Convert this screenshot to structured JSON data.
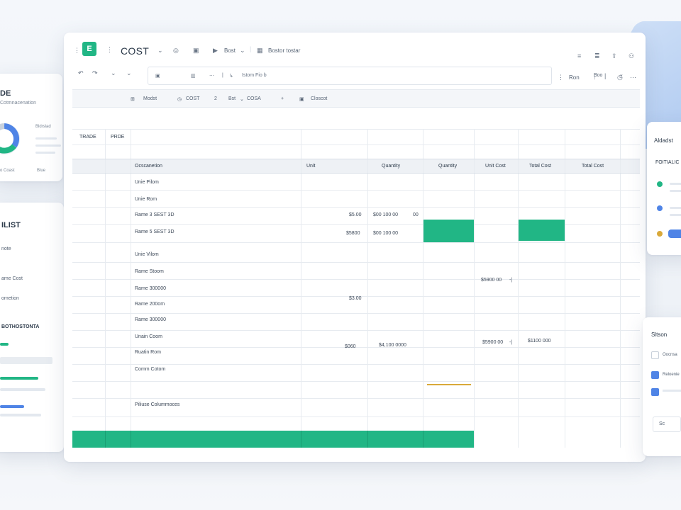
{
  "app": {
    "logo": "E",
    "title": "COST"
  },
  "toolbar": {
    "btn_a": "Bost",
    "btn_b": "Bostor tostar",
    "formula_text": "Istom Fio b",
    "select_value": "Boo",
    "right_text": "Ron"
  },
  "subtoolbar": [
    "Modst",
    "COST",
    "2",
    "Bst",
    "COSA",
    "Closcot"
  ],
  "grid": {
    "top_labels": {
      "trade": "TRADE",
      "pride": "PRDE"
    },
    "headers": [
      "Ocscanetion",
      "Unit",
      "Quantity",
      "Quantity",
      "Unit Cost",
      "Total Cost",
      "Total Cost"
    ],
    "rows": [
      {
        "name": "Unie Pilom",
        "unit": "",
        "qty": ""
      },
      {
        "name": "Unie Rom",
        "unit": "",
        "qty": ""
      },
      {
        "name": "Rame 3 SEST 3D",
        "unit": "$5.00",
        "qty": "$00 100 00",
        "extra": "00"
      },
      {
        "name": "Rame 5 SEST 3D",
        "unit": "$5800",
        "qty": "$00 100 00"
      },
      {
        "name": "Unie Vilom",
        "unit": "",
        "qty": ""
      },
      {
        "name": "Rame Stoom",
        "unit": "",
        "qty": ""
      },
      {
        "name": "Rame 300000",
        "unit": "",
        "qty": "",
        "unit_cost": "$5900 00"
      },
      {
        "name": "Rame 200om",
        "unit": "$3.00",
        "qty": ""
      },
      {
        "name": "Rame 300000",
        "unit": "",
        "qty": ""
      },
      {
        "name": "Unain Coom",
        "unit": "",
        "qty": ""
      },
      {
        "name": "Ruatin Rom",
        "unit": "$060",
        "qty": "$4,100 0000",
        "unit_cost": "$5900 00",
        "total_cost": "$1100 000"
      },
      {
        "name": "Comm Cotom",
        "unit": "",
        "qty": ""
      },
      {
        "name": "Piliuse Colummoces",
        "unit": "",
        "qty": ""
      }
    ]
  },
  "left_top": {
    "title": "DE",
    "subtitle": "Cotmnacenation",
    "label1": "Bldrslad",
    "label2": "o Coast",
    "label3": "Blue"
  },
  "left_bottom": {
    "title": "ILIST",
    "rows": [
      "note",
      "ame Cost",
      "ometion",
      "BOTHOSTONTA"
    ]
  },
  "right_top": {
    "title": "Aldadst",
    "subtitle": "FOITIALIC"
  },
  "right_bottom": {
    "title": "Sltson",
    "items": [
      "Oocnsa",
      "Reloenie",
      ""
    ],
    "select": "Sc"
  },
  "colors": {
    "accent": "#21b685",
    "blue": "#4f84e6",
    "gold": "#d9a93a"
  }
}
